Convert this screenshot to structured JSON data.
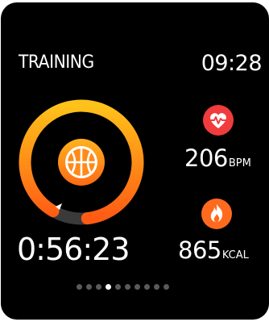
{
  "screen": {
    "title": "TRAINING",
    "time": "09:28",
    "workout_icon": "basketball-icon",
    "elapsed": "0:56:23",
    "heart_rate": {
      "value": "206",
      "unit": "BPM",
      "icon": "heart-icon"
    },
    "calories": {
      "value": "865",
      "unit": "KCAL",
      "icon": "flame-icon"
    },
    "pager": {
      "count": 10,
      "active_index": 3
    },
    "ring_progress": 0.9
  },
  "colors": {
    "background": "#000000",
    "ring_track": "#3a3a3a",
    "ring_start": "#ff5a14",
    "ring_end": "#ffc21a",
    "heart": "#f03c3c",
    "flame": "#ff6a1f",
    "text": "#ffffff"
  }
}
